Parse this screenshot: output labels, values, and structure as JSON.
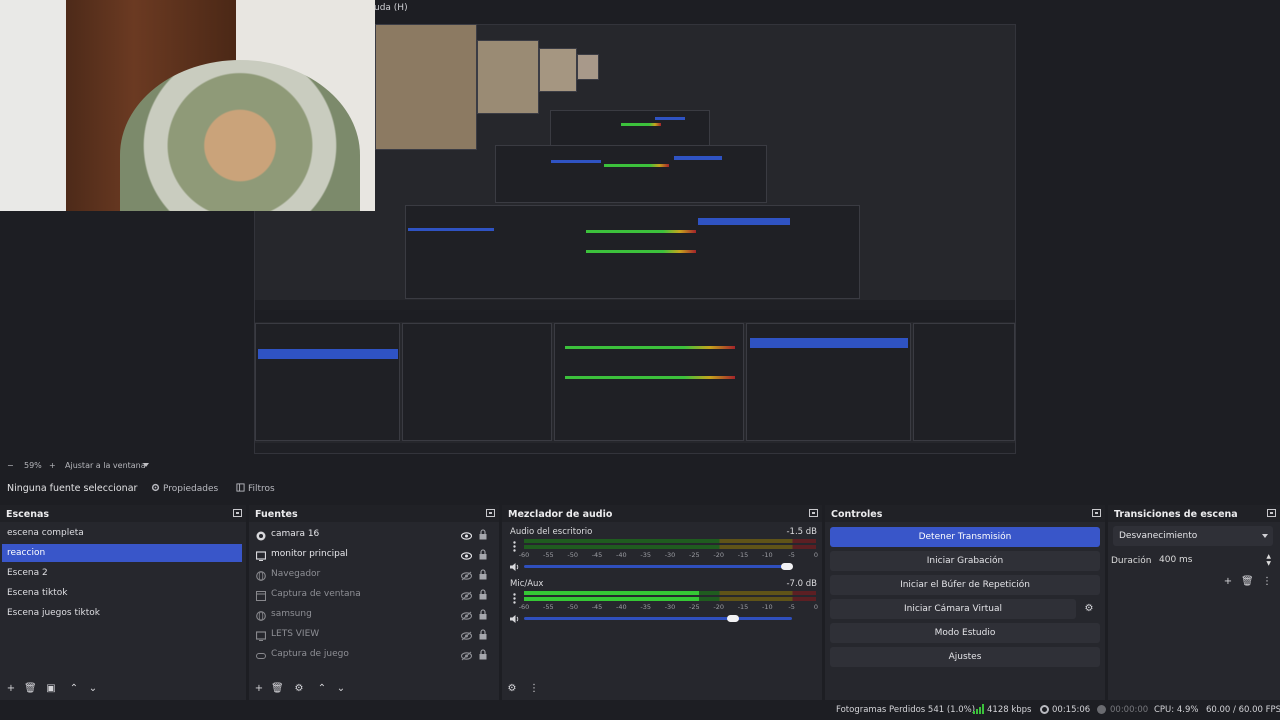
{
  "window": {
    "menu_fragment": "uda (H)"
  },
  "zoom": {
    "minus": "−",
    "level": "59%",
    "plus": "+",
    "fit_label": "Ajustar a la ventana"
  },
  "properties_bar": {
    "no_source": "Ninguna fuente seleccionar",
    "properties_label": "Propiedades",
    "filters_label": "Filtros"
  },
  "scenes": {
    "title": "Escenas",
    "items": [
      "escena completa",
      "reaccion",
      "Escena 2",
      "Escena tiktok",
      "Escena juegos tiktok"
    ],
    "active_index": 1
  },
  "sources": {
    "title": "Fuentes",
    "items": [
      {
        "name": "camara  16",
        "icon": "camera-icon",
        "visible": true
      },
      {
        "name": "monitor principal",
        "icon": "monitor-icon",
        "visible": true
      },
      {
        "name": "Navegador",
        "icon": "globe-icon",
        "visible": false
      },
      {
        "name": "Captura de ventana",
        "icon": "window-icon",
        "visible": false
      },
      {
        "name": "samsung",
        "icon": "globe-icon",
        "visible": false
      },
      {
        "name": "LETS VIEW",
        "icon": "monitor-icon",
        "visible": false
      },
      {
        "name": "Captura de juego",
        "icon": "gamepad-icon",
        "visible": false
      }
    ]
  },
  "mixer": {
    "title": "Mezclador de audio",
    "ticks": [
      "-60",
      "-55",
      "-50",
      "-45",
      "-40",
      "-35",
      "-30",
      "-25",
      "-20",
      "-15",
      "-10",
      "-5",
      "0"
    ],
    "channels": [
      {
        "name": "Audio del escritorio",
        "db": "-1.5 dB",
        "level": 0.0,
        "volume": 0.98
      },
      {
        "name": "Mic/Aux",
        "db": "-7.0 dB",
        "level": 0.6,
        "volume": 0.78
      }
    ]
  },
  "controls": {
    "title": "Controles",
    "buttons": [
      "Detener Transmisión",
      "Iniciar Grabación",
      "Iniciar el Búfer de Repetición",
      "Iniciar Cámara Virtual",
      "Modo Estudio",
      "Ajustes"
    ]
  },
  "transitions": {
    "title": "Transiciones de escena",
    "selected": "Desvanecimiento",
    "duration_label": "Duración",
    "duration_value": "400 ms"
  },
  "status": {
    "dropped": "Fotogramas Perdidos 541 (1.0%)",
    "bitrate": "4128 kbps",
    "live_time": "00:15:06",
    "rec_time": "00:00:00",
    "cpu": "CPU: 4.9%",
    "fps": "60.00 / 60.00 FPS"
  },
  "colors": {
    "accent": "#3956c9",
    "panel": "#26272d",
    "background": "#1d1e23"
  }
}
